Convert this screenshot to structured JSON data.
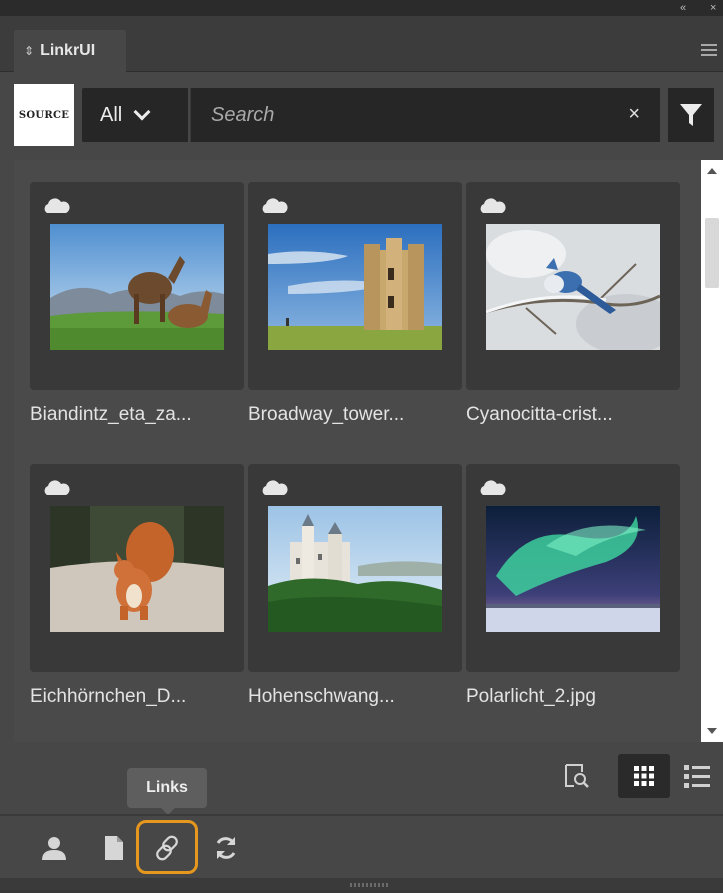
{
  "window": {
    "collapse_glyph": "«",
    "close_glyph": "×"
  },
  "panel": {
    "tab_label": "LinkrUI",
    "tab_icon": "updown-arrows-icon",
    "menu_icon": "hamburger-menu-icon"
  },
  "filter": {
    "source_logo_text": "SOURCE",
    "scope_value": "All",
    "search_placeholder": "Search",
    "search_value": "",
    "clear_glyph": "×",
    "filter_icon": "funnel-icon"
  },
  "assets": [
    {
      "name": "Biandintz_eta_za...",
      "icon": "cloud-icon"
    },
    {
      "name": "Broadway_tower...",
      "icon": "cloud-icon"
    },
    {
      "name": "Cyanocitta-crist...",
      "icon": "cloud-icon"
    },
    {
      "name": "Eichhörnchen_D...",
      "icon": "cloud-icon"
    },
    {
      "name": "Hohenschwang...",
      "icon": "cloud-icon"
    },
    {
      "name": "Polarlicht_2.jpg",
      "icon": "cloud-icon"
    }
  ],
  "view": {
    "preview_icon": "preview-magnifier-icon",
    "grid_icon": "grid-view-icon",
    "list_icon": "list-view-icon",
    "active": "grid"
  },
  "tooltip": {
    "text": "Links"
  },
  "footer": {
    "items": [
      {
        "name": "user",
        "icon": "user-icon"
      },
      {
        "name": "document",
        "icon": "document-icon"
      },
      {
        "name": "links",
        "icon": "link-icon",
        "highlighted": true
      },
      {
        "name": "sync",
        "icon": "sync-icon"
      }
    ],
    "highlight_color": "#e6971d"
  },
  "colors": {
    "panel_bg": "#474747",
    "input_bg": "#262626",
    "card_bg": "#393939"
  }
}
